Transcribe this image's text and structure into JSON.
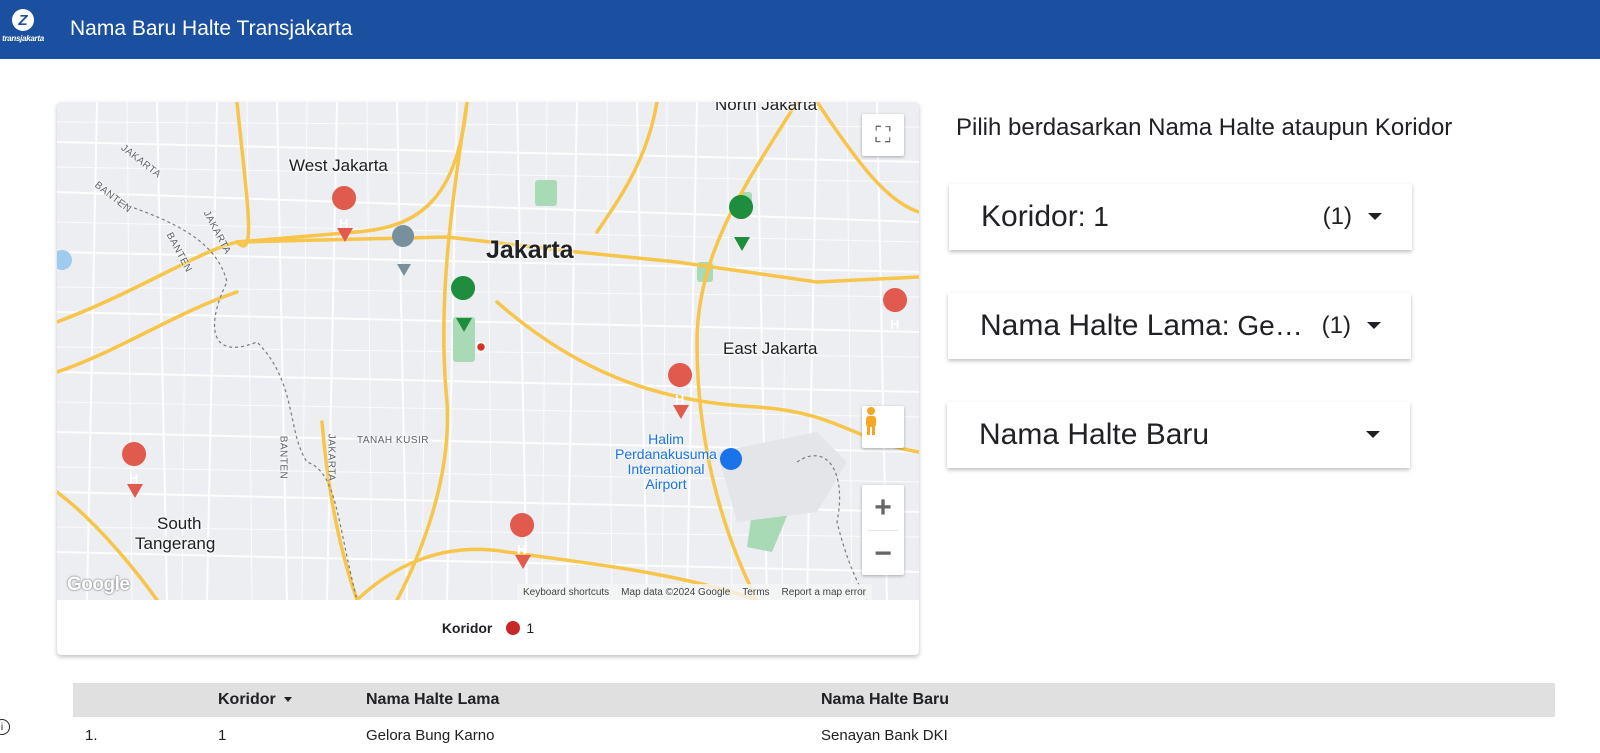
{
  "header": {
    "logo_text": "transjakarta",
    "title": "Nama Baru Halte Transjakarta"
  },
  "map": {
    "labels": {
      "north_jakarta": "North Jakarta",
      "west_jakarta": "West Jakarta",
      "jakarta": "Jakarta",
      "east_jakarta": "East Jakarta",
      "south_tangerang_1": "South",
      "south_tangerang_2": "Tangerang",
      "tanah_kusir": "TANAH KUSIR",
      "halim_1": "Halim",
      "halim_2": "Perdanakusuma",
      "halim_3": "International",
      "halim_4": "Airport",
      "jakarta_banten_1": "JAKARTA",
      "jakarta_banten_2": "BANTEN",
      "jakarta_banten_3": "JAKARTA",
      "jakarta_banten_4": "BANTEN",
      "banten_s": "BANTEN",
      "jakarta_s": "JAKARTA"
    },
    "google_logo": "Google",
    "attribution": {
      "shortcuts": "Keyboard shortcuts",
      "data": "Map data ©2024 Google",
      "terms": "Terms",
      "report": "Report a map error"
    },
    "zoom_in": "+",
    "zoom_out": "−",
    "legend": {
      "title": "Koridor",
      "value": "1",
      "color": "#c62828"
    }
  },
  "filters": {
    "prompt": "Pilih berdasarkan Nama Halte ataupun Koridor",
    "koridor": {
      "label": "Koridor",
      "value": ": 1",
      "count": "(1)"
    },
    "halte_lama": {
      "label": "Nama Halte Lama",
      "value": ": Ge…",
      "count": "(1)"
    },
    "halte_baru": {
      "label": "Nama Halte Baru",
      "value": "",
      "count": ""
    }
  },
  "table": {
    "headers": [
      "",
      "Koridor",
      "Nama Halte Lama",
      "Nama Halte Baru"
    ],
    "rows": [
      {
        "no": "1.",
        "koridor": "1",
        "lama": "Gelora Bung Karno",
        "baru": "Senayan Bank DKI"
      }
    ]
  },
  "colors": {
    "header_bg": "#1a509f",
    "marker_red": "#c62828",
    "road_yellow": "#f6c54a"
  }
}
